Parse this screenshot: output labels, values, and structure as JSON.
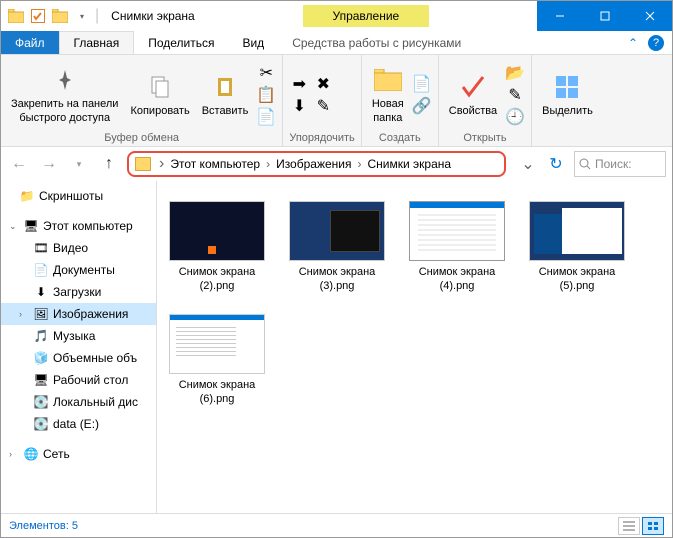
{
  "title": "Снимки экрана",
  "context_tab": "Управление",
  "tabs": {
    "file": "Файл",
    "home": "Главная",
    "share": "Поделиться",
    "view": "Вид",
    "tools": "Средства работы с рисунками"
  },
  "ribbon": {
    "pin": "Закрепить на панели\nбыстрого доступа",
    "copy": "Копировать",
    "paste": "Вставить",
    "clipboard_group": "Буфер обмена",
    "organize_group": "Упорядочить",
    "newfolder": "Новая\nпапка",
    "new_group": "Создать",
    "properties": "Свойства",
    "open_group": "Открыть",
    "select": "Выделить"
  },
  "breadcrumbs": [
    "Этот компьютер",
    "Изображения",
    "Снимки экрана"
  ],
  "search_placeholder": "Поиск:",
  "sidebar": {
    "screenshots": "Скриншоты",
    "thispc": "Этот компьютер",
    "videos": "Видео",
    "documents": "Документы",
    "downloads": "Загрузки",
    "pictures": "Изображения",
    "music": "Музыка",
    "objects3d": "Объемные объ",
    "desktop": "Рабочий стол",
    "localdisk": "Локальный дис",
    "datae": "data (E:)",
    "network": "Сеть"
  },
  "files": [
    {
      "name": "Снимок экрана (2).png",
      "thumb": "dark"
    },
    {
      "name": "Снимок экрана (3).png",
      "thumb": "win1"
    },
    {
      "name": "Снимок экрана (4).png",
      "thumb": "win2"
    },
    {
      "name": "Снимок экрана (5).png",
      "thumb": "win3"
    },
    {
      "name": "Снимок экрана (6).png",
      "thumb": "doc"
    }
  ],
  "status": "Элементов: 5"
}
